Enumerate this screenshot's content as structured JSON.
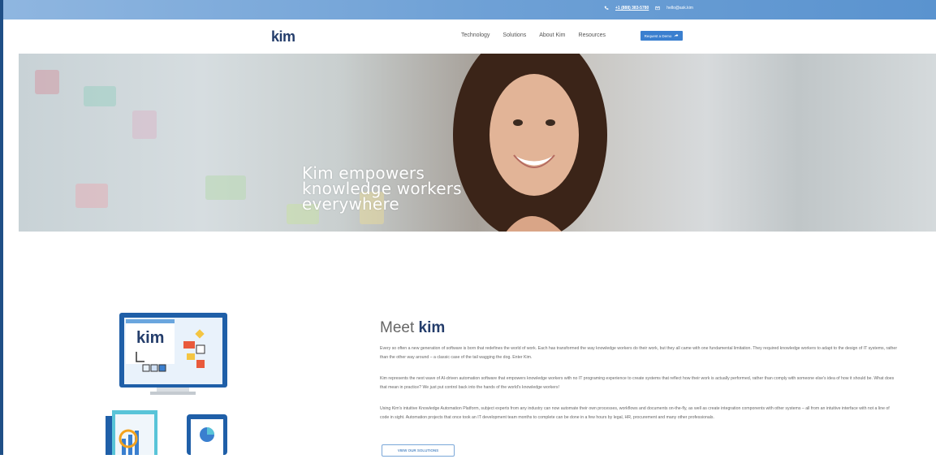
{
  "topbar": {
    "phone": "+1 (888) 383-5780",
    "email": "hello@ask.kim"
  },
  "brand": {
    "logo_text": "kim"
  },
  "nav": {
    "items": [
      {
        "label": "Technology"
      },
      {
        "label": "Solutions"
      },
      {
        "label": "About Kim"
      },
      {
        "label": "Resources"
      }
    ],
    "demo_button": "Request a Demo"
  },
  "hero": {
    "title": "Kim empowers\nknowledge workers\neverywhere"
  },
  "meet": {
    "heading_prefix": "Meet",
    "heading_brand": "kim",
    "paragraphs": [
      "Every so often a new generation of software is born that redefines the world of work. Each has transformed the way knowledge workers do their work, but they all came with one fundamental limitation. They required knowledge workers to adapt to the design of IT systems, rather than the other way around – a classic case of the tail wagging the dog. Enter Kim.",
      "Kim represents the next wave of AI-driven automation software that empowers knowledge workers with no IT programing experience to create systems that reflect how their work is actually performed, rather than comply with someone else's idea of how it should be. What does that mean in practice? We just put control back into the hands of the world's knowledge workers!",
      "Using Kim's intuitive Knowledge Automation Platform, subject experts from any industry can now automate their own processes, workflows and documents on-the-fly, as well as create integration components with other systems – all from an intuitive interface with not a line of code in sight. Automation projects that once took an IT development team months to complete can be done in a few hours by legal, HR, procurement and many other professionals."
    ],
    "cta": "VIEW OUR SOLUTIONS"
  },
  "illustration": {
    "monitor_logo": "kim"
  },
  "colors": {
    "brand_dark": "#243d6b",
    "brand_accent": "#4a90d9",
    "topbar": "#6fa1d6"
  }
}
